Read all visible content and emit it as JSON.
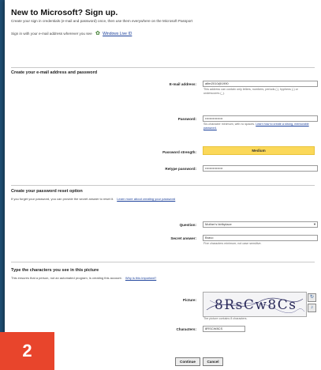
{
  "header": {
    "title": "New to Microsoft? Sign up.",
    "tagline": "Create your sign in credentials (e-mail and password) once, then use them everywhere on the Microsoft Passport",
    "signin_text": "Sign in with your e-mail address wherever you see",
    "signin_link": "Windows Live ID"
  },
  "section_account": {
    "heading": "Create your e-mail address and password",
    "email_label": "E-mail address:",
    "email_value": "alfer2010@1990",
    "email_hint": "This address can contain only letters, numbers, periods (.), hyphens (-) or underscores (_).",
    "password_label": "Password:",
    "password_value": "••••••••••••••••",
    "password_hint": "Six-character minimum, with no spaces.",
    "password_hint_link": "Learn how to create a strong, memorable password.",
    "strength_label": "Password strength:",
    "strength_value": "Medium",
    "retype_label": "Retype password:",
    "retype_value": "••••••••••••••••"
  },
  "section_reset": {
    "heading": "Create your password reset option",
    "subtext": "If you forget your password, you can provide the secret answer to reset it.",
    "subtext_link": "Learn more about creating your password",
    "question_label": "Question:",
    "question_value": "Mother's birthplace",
    "answer_label": "Secret answer:",
    "answer_value": "Bravo",
    "answer_hint": "Five characters minimum; not case sensitive."
  },
  "section_captcha": {
    "heading": "Type the characters you see in this picture",
    "subtext": "This ensures that a person, not an automated program, is creating this account.",
    "subtext_link": "Why is this important?",
    "picture_label": "Picture:",
    "captcha_text": "8RsCw8Cs",
    "captcha_hint": "The picture contains 8 characters.",
    "characters_label": "Characters:",
    "characters_value": "8RSCW8CS"
  },
  "actions": {
    "continue_label": "Continue",
    "cancel_label": "Cancel"
  },
  "badge": {
    "number": "2"
  },
  "colors": {
    "background": "#1e4e73",
    "strength": "#fbd859",
    "badge": "#e8452c",
    "link": "#1a3f9a"
  }
}
